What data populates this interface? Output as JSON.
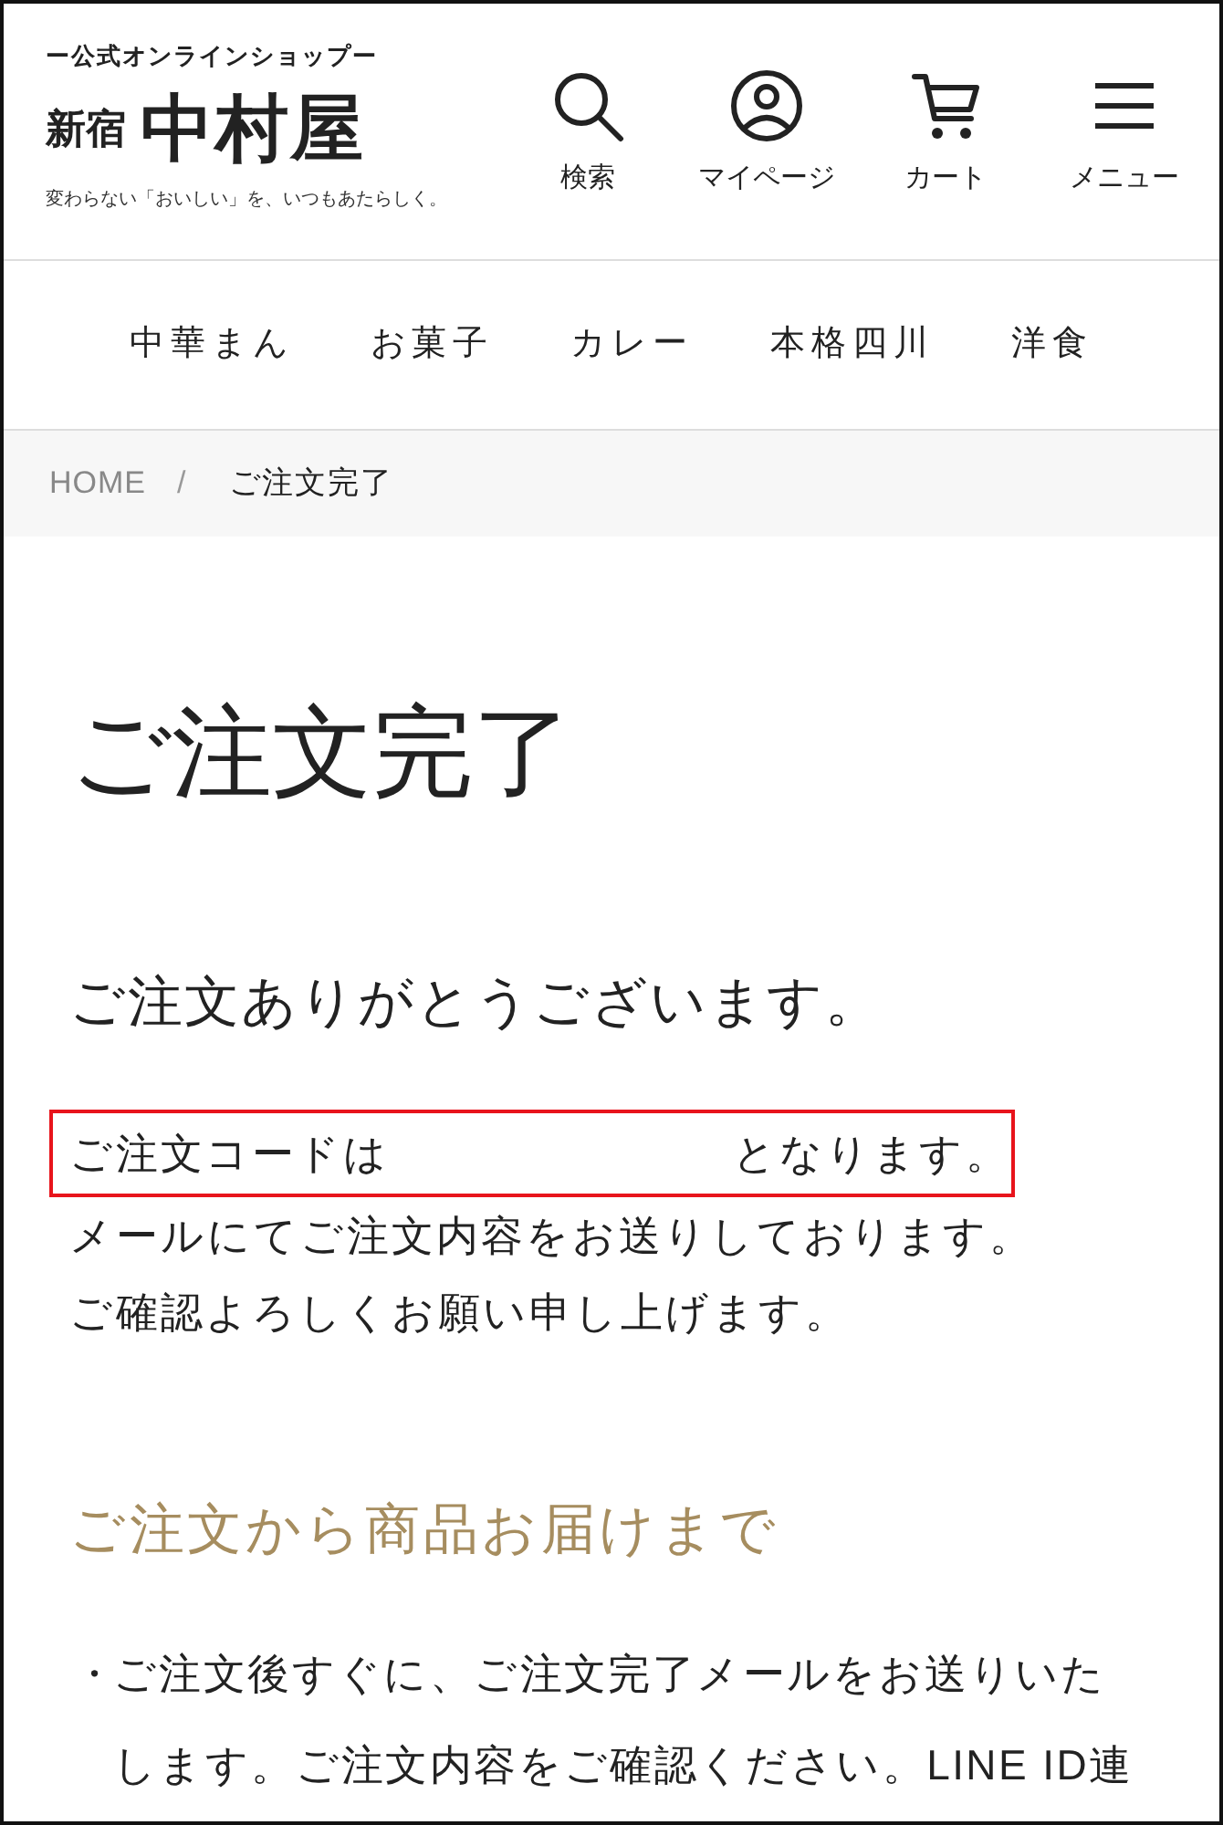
{
  "header": {
    "logo": {
      "tagline": "ー公式オンラインショップー",
      "name_prefix": "新宿",
      "name": "中村屋",
      "slogan": "変わらない「おいしい」を、いつもあたらしく。"
    },
    "actions": [
      {
        "kind": "search",
        "label": "検索"
      },
      {
        "kind": "account",
        "label": "マイページ"
      },
      {
        "kind": "cart",
        "label": "カート"
      },
      {
        "kind": "menu",
        "label": "メニュー"
      }
    ]
  },
  "categories": [
    {
      "label": "中華まん"
    },
    {
      "label": "お菓子"
    },
    {
      "label": "カレー"
    },
    {
      "label": "本格四川"
    },
    {
      "label": "洋食"
    }
  ],
  "breadcrumb": {
    "items": [
      {
        "label": "HOME",
        "current": false
      },
      {
        "label": "ご注文完了",
        "current": true
      }
    ],
    "separator": "/"
  },
  "page_title": "ご注文完了",
  "thanks_heading": "ご注文ありがとうございます。",
  "order_code_notice": {
    "before": "ご注文コードは",
    "after": "となります。",
    "highlighted": true
  },
  "messages": [
    "メールにてご注文内容をお送りしております。",
    "ご確認よろしくお願い申し上げます。"
  ],
  "flow_heading": "ご注文から商品お届けまで",
  "flow_notes": [
    {
      "marker": "・",
      "text": "ご注文後すぐに、ご注文完了メールをお送りいたします。ご注文内容をご確認ください。LINE ID連"
    }
  ]
}
